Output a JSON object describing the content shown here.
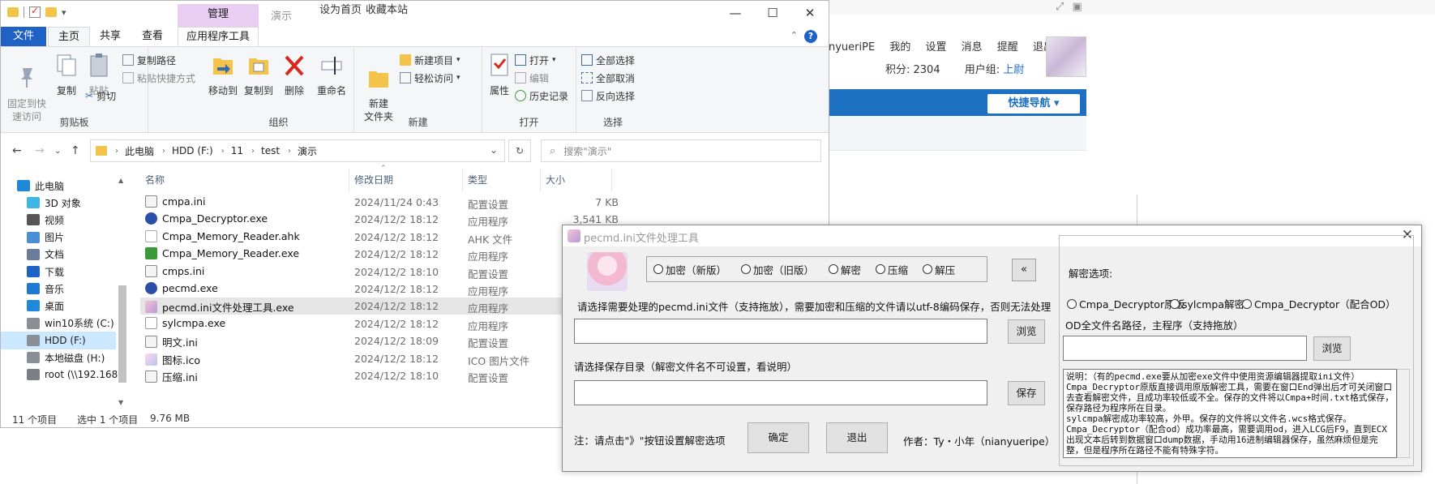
{
  "browser": {
    "user_links": [
      "nyueriPE",
      "我的",
      "设置",
      "消息",
      "提醒",
      "退出"
    ],
    "points_label": "积分: 2304",
    "group_label": "用户组:",
    "group_value": "上尉",
    "quick_nav": "快捷导航"
  },
  "explorer": {
    "context_tab": "管理",
    "title": "演示",
    "top_links": [
      "设为首页",
      "收藏本站"
    ],
    "tabs": [
      "文件",
      "主页",
      "共享",
      "查看",
      "应用程序工具"
    ],
    "ribbon": {
      "clipboard": {
        "label": "剪贴板",
        "pin": "固定到快\n速访问",
        "copy": "复制",
        "paste": "粘贴",
        "copy_path": "复制路径",
        "paste_shortcut": "粘贴快捷方式",
        "cut": "剪切"
      },
      "organize": {
        "label": "组织",
        "move_to": "移动到",
        "copy_to": "复制到",
        "delete": "删除",
        "rename": "重命名"
      },
      "new": {
        "label": "新建",
        "new_folder": "新建\n文件夹",
        "new_item": "新建项目",
        "easy_access": "轻松访问"
      },
      "open": {
        "label": "打开",
        "properties": "属性",
        "open": "打开",
        "edit": "编辑",
        "history": "历史记录"
      },
      "select": {
        "label": "选择",
        "select_all": "全部选择",
        "select_none": "全部取消",
        "invert": "反向选择"
      }
    },
    "address": [
      "此电脑",
      "HDD (F:)",
      "11",
      "test",
      "演示"
    ],
    "search_placeholder": "搜索\"演示\"",
    "nav": [
      {
        "label": "此电脑",
        "icon": "pc-icon"
      },
      {
        "label": "3D 对象",
        "icon": "cube-icon"
      },
      {
        "label": "视频",
        "icon": "video-icon"
      },
      {
        "label": "图片",
        "icon": "image-icon"
      },
      {
        "label": "文档",
        "icon": "document-icon"
      },
      {
        "label": "下载",
        "icon": "download-icon"
      },
      {
        "label": "音乐",
        "icon": "music-icon"
      },
      {
        "label": "桌面",
        "icon": "desktop-icon"
      },
      {
        "label": "win10系统 (C:)",
        "icon": "drive-icon"
      },
      {
        "label": "HDD (F:)",
        "icon": "drive-icon"
      },
      {
        "label": "本地磁盘 (H:)",
        "icon": "drive-icon"
      },
      {
        "label": "root (\\\\192.168",
        "icon": "network-drive-icon"
      }
    ],
    "columns": [
      "名称",
      "修改日期",
      "类型",
      "大小"
    ],
    "files": [
      {
        "name": "cmpa.ini",
        "date": "2024/11/24 0:43",
        "type": "配置设置",
        "size": "7 KB",
        "icon": "ini"
      },
      {
        "name": "Cmpa_Decryptor.exe",
        "date": "2024/12/2 18:12",
        "type": "应用程序",
        "size": "3,541 KB",
        "icon": "exe-q"
      },
      {
        "name": "Cmpa_Memory_Reader.ahk",
        "date": "2024/12/2 18:12",
        "type": "AHK 文件",
        "size": "",
        "icon": "ahk"
      },
      {
        "name": "Cmpa_Memory_Reader.exe",
        "date": "2024/12/2 18:12",
        "type": "应用程序",
        "size": "",
        "icon": "exe-h"
      },
      {
        "name": "cmps.ini",
        "date": "2024/12/2 18:10",
        "type": "配置设置",
        "size": "",
        "icon": "ini"
      },
      {
        "name": "pecmd.exe",
        "date": "2024/12/2 18:12",
        "type": "应用程序",
        "size": "",
        "icon": "exe-q"
      },
      {
        "name": "pecmd.ini文件处理工具.exe",
        "date": "2024/12/2 18:12",
        "type": "应用程序",
        "size": "",
        "icon": "exe-p"
      },
      {
        "name": "sylcmpa.exe",
        "date": "2024/12/2 18:12",
        "type": "应用程序",
        "size": "",
        "icon": "exe-s"
      },
      {
        "name": "明文.ini",
        "date": "2024/12/2 18:09",
        "type": "配置设置",
        "size": "",
        "icon": "ini"
      },
      {
        "name": "图标.ico",
        "date": "2024/12/2 18:12",
        "type": "ICO 图片文件",
        "size": "",
        "icon": "ico"
      },
      {
        "name": "压缩.ini",
        "date": "2024/12/2 18:10",
        "type": "配置设置",
        "size": "",
        "icon": "ini"
      }
    ],
    "status": {
      "count": "11 个项目",
      "selected": "选中 1 个项目",
      "size": "9.76 MB"
    }
  },
  "dialog": {
    "title": "pecmd.ini文件处理工具",
    "modes": [
      "加密（新版）",
      "加密（旧版）",
      "解密",
      "压缩",
      "解压"
    ],
    "expand_btn": "«",
    "source_label": "请选择需要处理的pecmd.ini文件（支持拖放），需要加密和压缩的文件请以utf-8编码保存，否则无法处理",
    "browse": "浏览",
    "save_label": "请选择保存目录（解密文件名不可设置，看说明）",
    "save": "保存",
    "hint": "注：请点击\"》\"按钮设置解密选项",
    "ok": "确定",
    "exit": "退出",
    "author": "作者：Ty・小年（nianyueripe）",
    "dec_title": "解密选项:",
    "dec_options": [
      "Cmpa_Decryptor原版",
      "sylcmpa解密",
      "Cmpa_Decryptor（配合OD）"
    ],
    "od_label": "OD全文件名路径，主程序（支持拖放）",
    "dec_browse": "浏览",
    "notes": "说明：（有的pecmd.exe要从加密exe文件中使用资源编辑器提取ini文件）\nCmpa_Decryptor原版直接调用原版解密工具，需要在窗口End弹出后才可关闭窗口去查看解密文件，且成功率较低或不全。保存的文件将以Cmpa+时间.txt格式保存，保存路径为程序所在目录。\nsylcmpa解密成功率较高，外甲。保存的文件将以文件名.wcs格式保存。\nCmpa_Decryptor（配合od）成功率最高，需要调用od，进入LCG后F9，直到ECX出现文本后转到数据窗口dump数据，手动用16进制编辑器保存，虽然麻烦但是完整，但是程序所在路径不能有特殊字符。"
  }
}
